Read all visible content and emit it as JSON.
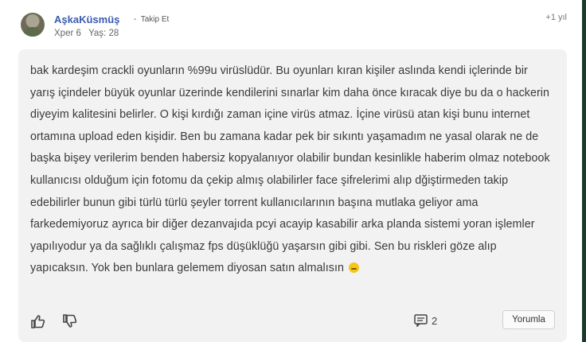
{
  "header": {
    "username": "AşkaKüsmüş",
    "follow_label": "Takip Et",
    "follow_prefix": "-",
    "gender": "Xper 6",
    "age": "Yaş: 28",
    "votes": "+1 yıl"
  },
  "comment": {
    "text": "bak kardeşim crackli oyunların %99u virüslüdür. Bu oyunları kıran kişiler aslında kendi içlerinde bir yarış içindeler büyük oyunlar üzerinde kendilerini sınarlar kim daha önce kıracak diye bu da o hackerin diyeyim kalitesini belirler. O kişi kırdığı zaman içine virüs atmaz. İçine virüsü atan kişi bunu internet ortamına upload eden kişidir. Ben bu zamana kadar pek bir sıkıntı yaşamadım ne yasal olarak ne de başka bişey verilerim benden habersiz kopyalanıyor olabilir bundan kesinlikle haberim olmaz notebook kullanıcısı olduğum için fotomu da çekip almış olabilirler face şifrelerimi alıp dğiştirmeden takip edebilirler bunun gibi türlü türlü şeyler torrent kullanıcılarının başına mutlaka geliyor ama farkedemiyoruz ayrıca bir diğer dezanvajıda pcyi acayip kasabilir arka planda sistemi yoran işlemler yapılıyodur ya da sağlıklı çalışmaz fps düşüklüğü yaşarsın gibi gibi. Sen bu riskleri göze alıp yapıcaksın. Yok ben bunlara gelemem diyosan satın almalısın",
    "emoji": "unamused-face-icon"
  },
  "actions": {
    "like_icon": "thumbs-up-icon",
    "dislike_icon": "thumbs-down-icon",
    "comment_icon": "comment-icon",
    "comment_count": "2",
    "reply_label": "Yorumla"
  }
}
